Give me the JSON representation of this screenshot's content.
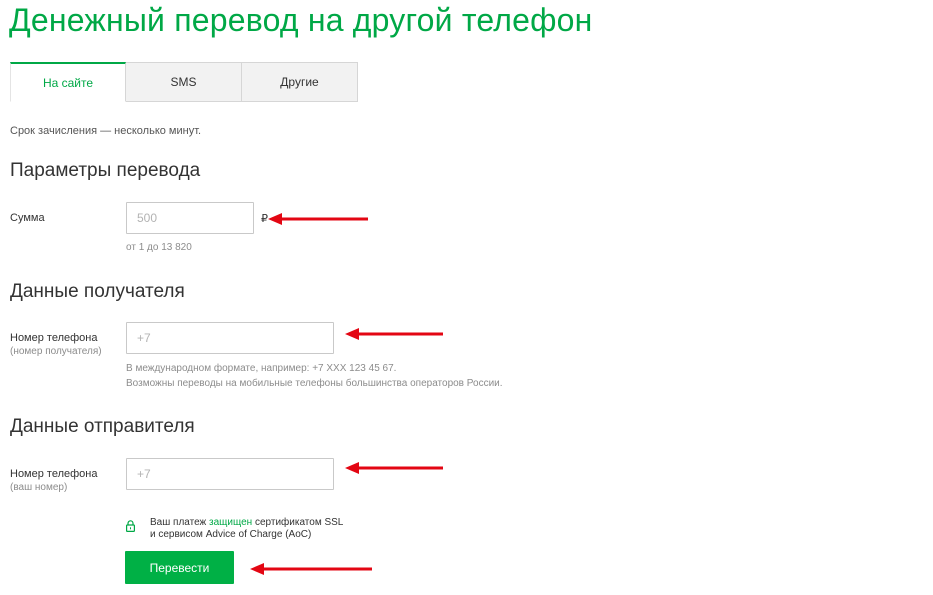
{
  "page": {
    "title": "Денежный перевод на другой телефон"
  },
  "tabs": [
    {
      "label": "На сайте",
      "active": true
    },
    {
      "label": "SMS",
      "active": false
    },
    {
      "label": "Другие",
      "active": false
    }
  ],
  "note": "Срок зачисления — несколько минут.",
  "transfer": {
    "heading": "Параметры перевода",
    "amount_label": "Сумма",
    "amount_placeholder": "500",
    "currency_symbol": "₽",
    "amount_hint": "от 1 до 13 820"
  },
  "recipient": {
    "heading": "Данные получателя",
    "phone_label": "Номер телефона",
    "phone_sublabel": "(номер получателя)",
    "phone_placeholder": "+7",
    "hint_1": "В международном формате, например: +7 XXX 123 45 67.",
    "hint_2": "Возможны переводы на мобильные телефоны большинства операторов России."
  },
  "sender": {
    "heading": "Данные отправителя",
    "phone_label": "Номер телефона",
    "phone_sublabel": "(ваш номер)",
    "phone_placeholder": "+7"
  },
  "security": {
    "icon": "lock-icon",
    "text_before": "Ваш платеж",
    "link": "защищен",
    "text_after": "сертификатом SSL",
    "line_2": "и сервисом Advice of Charge (AoC)"
  },
  "submit_label": "Перевести",
  "colors": {
    "brand_green": "#00a846",
    "button_green": "#00b045",
    "arrow_red": "#e30613"
  }
}
